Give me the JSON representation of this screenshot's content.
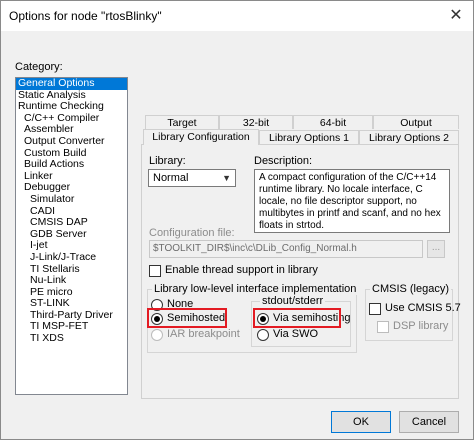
{
  "window": {
    "title": "Options for node \"rtosBlinky\"",
    "close_glyph": "✕"
  },
  "category": {
    "label": "Category:",
    "items": [
      {
        "label": "General Options",
        "level": 0,
        "selected": true
      },
      {
        "label": "Static Analysis",
        "level": 0
      },
      {
        "label": "Runtime Checking",
        "level": 0
      },
      {
        "label": "C/C++ Compiler",
        "level": 1
      },
      {
        "label": "Assembler",
        "level": 1
      },
      {
        "label": "Output Converter",
        "level": 1
      },
      {
        "label": "Custom Build",
        "level": 1
      },
      {
        "label": "Build Actions",
        "level": 1
      },
      {
        "label": "Linker",
        "level": 1
      },
      {
        "label": "Debugger",
        "level": 1
      },
      {
        "label": "Simulator",
        "level": 2
      },
      {
        "label": "CADI",
        "level": 2
      },
      {
        "label": "CMSIS DAP",
        "level": 2
      },
      {
        "label": "GDB Server",
        "level": 2
      },
      {
        "label": "I-jet",
        "level": 2
      },
      {
        "label": "J-Link/J-Trace",
        "level": 2
      },
      {
        "label": "TI Stellaris",
        "level": 2
      },
      {
        "label": "Nu-Link",
        "level": 2
      },
      {
        "label": "PE micro",
        "level": 2
      },
      {
        "label": "ST-LINK",
        "level": 2
      },
      {
        "label": "Third-Party Driver",
        "level": 2
      },
      {
        "label": "TI MSP-FET",
        "level": 2
      },
      {
        "label": "TI XDS",
        "level": 2
      }
    ]
  },
  "tabs": {
    "row1": [
      "Target",
      "32-bit",
      "64-bit",
      "Output"
    ],
    "row2": [
      "Library Configuration",
      "Library Options 1",
      "Library Options 2"
    ]
  },
  "library": {
    "label": "Library:",
    "value": "Normal"
  },
  "description": {
    "label": "Description:",
    "text": "A compact configuration of the C/C++14 runtime library. No locale interface, C locale, no file descriptor support, no multibytes in printf and scanf, and no hex floats in strtod."
  },
  "config_file": {
    "label": "Configuration file:",
    "value": "$TOOLKIT_DIR$\\inc\\c\\DLib_Config_Normal.h",
    "browse": "..."
  },
  "thread_support": {
    "label": "Enable thread support in library",
    "checked": false
  },
  "lowlevel": {
    "title": "Library low-level interface implementation",
    "none": "None",
    "semihosted": "Semihosted",
    "iar_breakpoint": "IAR breakpoint",
    "stdout_title": "stdout/stderr",
    "via_semihosting": "Via semihosting",
    "via_swo": "Via SWO"
  },
  "cmsis": {
    "title": "CMSIS (legacy)",
    "use_cmsis": "Use CMSIS 5.7",
    "dsp_library": "DSP library"
  },
  "buttons": {
    "ok": "OK",
    "cancel": "Cancel"
  },
  "colors": {
    "selection": "#0078d7",
    "highlight": "#e31b23"
  }
}
